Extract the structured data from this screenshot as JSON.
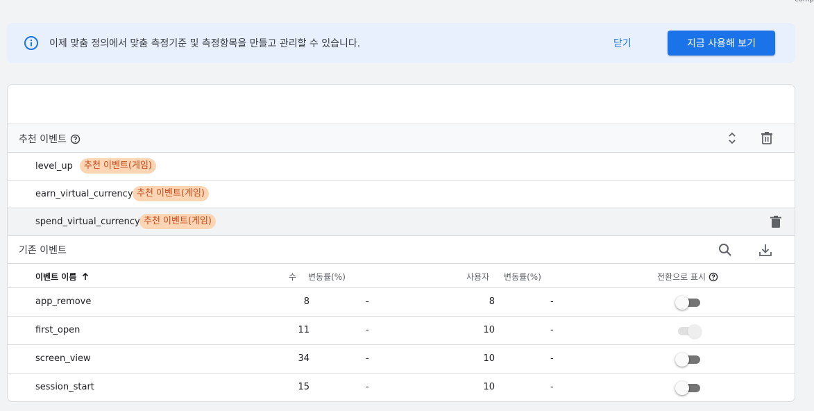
{
  "corner_text": "comp",
  "banner": {
    "message": "이제 맞춤 정의에서 맞춤 측정기준 및 측정항목을 만들고 관리할 수 있습니다.",
    "close_label": "닫기",
    "primary_label": "지금 사용해 보기",
    "icon": "info-icon"
  },
  "recommended": {
    "title": "추천 이벤트",
    "events": [
      {
        "name": "level_up",
        "chip": "추천 이벤트(게임)"
      },
      {
        "name": "earn_virtual_currency",
        "chip": "추천 이벤트(게임)"
      },
      {
        "name": "spend_virtual_currency",
        "chip": "추천 이벤트(게임)"
      }
    ]
  },
  "existing": {
    "title": "기존 이벤트",
    "columns": {
      "name": "이벤트 이름",
      "count": "수",
      "count_change": "변동률(%)",
      "users": "사용자",
      "users_change": "변동률(%)",
      "conversion": "전환으로 표시"
    },
    "rows": [
      {
        "name": "app_remove",
        "count": "8",
        "count_change": "-",
        "users": "8",
        "users_change": "-",
        "conversion": false
      },
      {
        "name": "first_open",
        "count": "11",
        "count_change": "-",
        "users": "10",
        "users_change": "-",
        "conversion": true
      },
      {
        "name": "screen_view",
        "count": "34",
        "count_change": "-",
        "users": "10",
        "users_change": "-",
        "conversion": false
      },
      {
        "name": "session_start",
        "count": "15",
        "count_change": "-",
        "users": "10",
        "users_change": "-",
        "conversion": false
      }
    ]
  },
  "colors": {
    "accent": "#1a73e8",
    "banner_bg": "#e8f0fe",
    "chip_bg": "#fcd5b5",
    "chip_text": "#c5491a"
  }
}
